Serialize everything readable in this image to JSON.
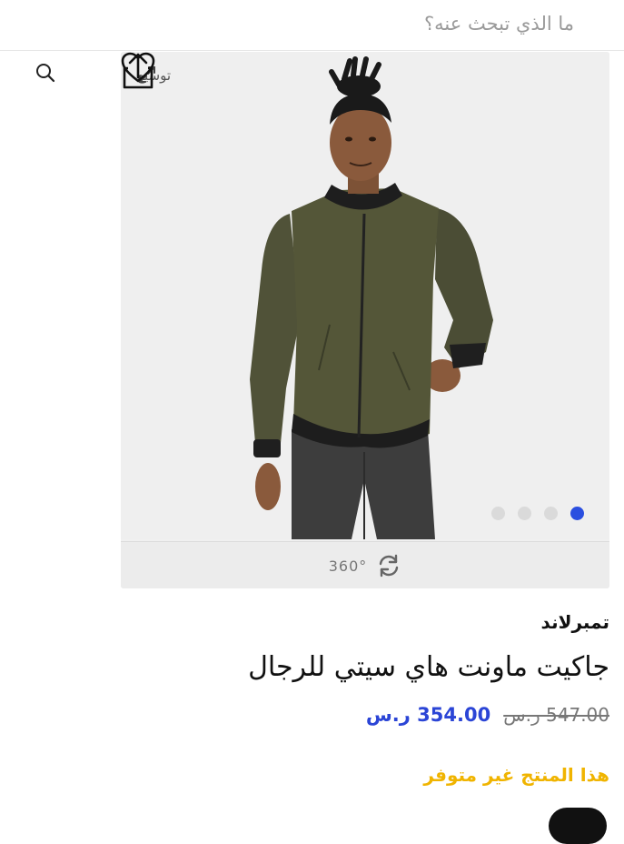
{
  "search": {
    "placeholder": "ما الذي تبحث عنه؟"
  },
  "gallery": {
    "expand_label": "توسيع",
    "rotate_label": "360°",
    "dots_total": 4,
    "active_dot": 1
  },
  "product": {
    "brand": "تمبرلاند",
    "title": "جاكيت ماونت هاي سيتي للرجال",
    "old_price": "547.00 ر.س",
    "new_price": "354.00 ر.س",
    "availability": "هذا المنتج غير متوفر"
  },
  "colors": {
    "accent": "#2b4fe0",
    "price": "#2b45d6",
    "warning": "#f0b400",
    "jacket": "#4e4f36"
  }
}
